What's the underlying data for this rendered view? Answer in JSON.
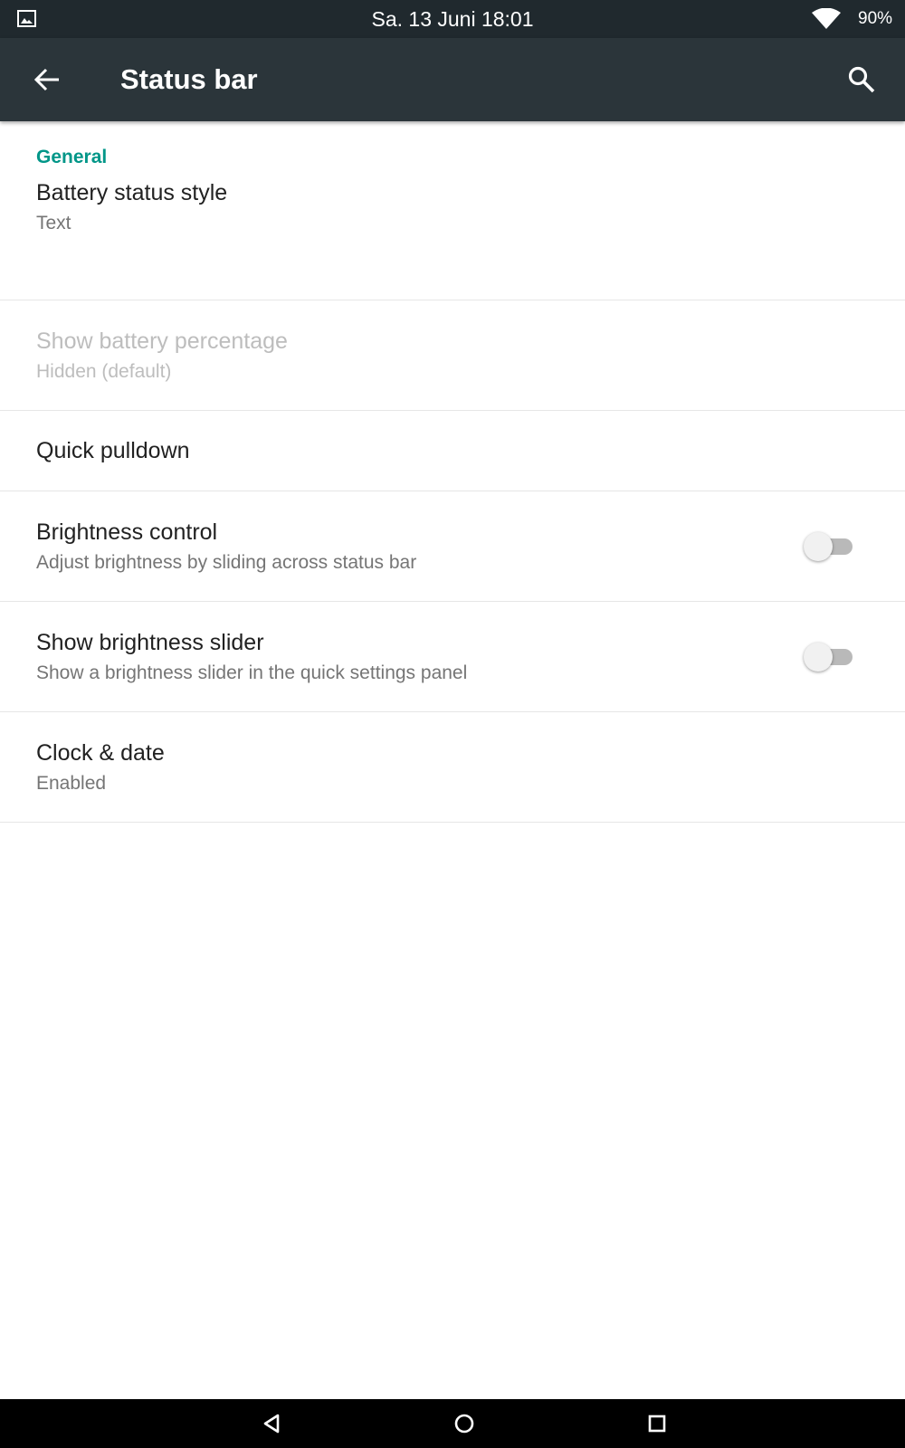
{
  "status_bar": {
    "time": "Sa. 13 Juni 18:01",
    "battery": "90%",
    "icons": [
      "image-notification-icon",
      "wifi-icon"
    ]
  },
  "app_bar": {
    "title": "Status bar",
    "icons": [
      "back-arrow-icon",
      "search-icon"
    ],
    "background": "#2b353a"
  },
  "settings": {
    "category": "General",
    "accent": "#009688",
    "items": [
      {
        "title": "Battery status style",
        "summary": "Text",
        "enabled": true
      },
      {
        "title": "Show battery percentage",
        "summary": "Hidden (default)",
        "enabled": false
      },
      {
        "title": "Quick pulldown",
        "enabled": true
      },
      {
        "title": "Brightness control",
        "summary": "Adjust brightness by sliding across status bar",
        "switch": false
      },
      {
        "title": "Show brightness slider",
        "summary": "Show a brightness slider in the quick settings panel",
        "switch": false
      },
      {
        "title": "Clock & date",
        "summary": "Enabled",
        "enabled": true
      }
    ]
  },
  "nav_bar": {
    "icons": [
      "back-triangle-icon",
      "home-circle-icon",
      "recents-square-icon"
    ]
  }
}
